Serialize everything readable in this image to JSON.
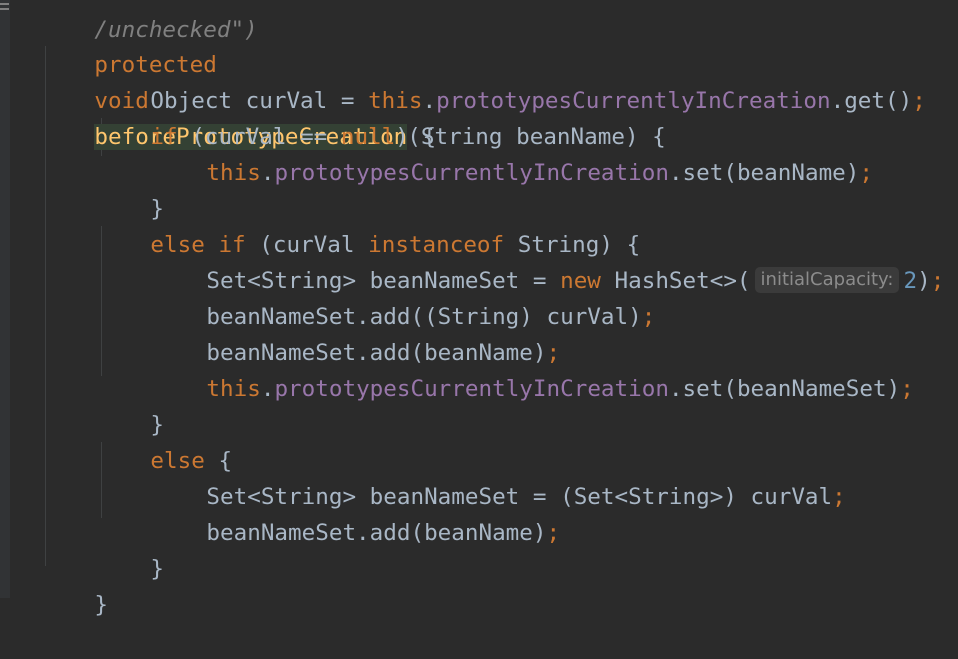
{
  "editor": {
    "annotation_partial": "/unchecked\")",
    "signature": {
      "kw_protected": "protected",
      "kw_void": "void",
      "method_name": "beforePrototypeCreation",
      "params": "(String beanName) {"
    },
    "lines": {
      "l2_type": "Object curVal = ",
      "l2_this": "this",
      "l2_dot": ".",
      "l2_field": "prototypesCurrentlyInCreation",
      "l2_rest": ".get()",
      "l2_semi": ";",
      "l3_kw": "if",
      "l3_mid": " (curVal == ",
      "l3_null": "null",
      "l3_rest": ") {",
      "l4_this": "this",
      "l4_dot": ".",
      "l4_field": "prototypesCurrentlyInCreation",
      "l4_rest": ".set(beanName)",
      "l4_semi": ";",
      "l5": "}",
      "l6_else": "else",
      "l6_if": "if",
      "l6_mid": " (curVal ",
      "l6_instanceof": "instanceof",
      "l6_rest": " String) {",
      "l7_a": "Set<String> beanNameSet = ",
      "l7_new": "new",
      "l7_b": " HashSet<>(",
      "l7_hint": "initialCapacity:",
      "l7_num": "2",
      "l7_c": ")",
      "l7_semi": ";",
      "l8": "beanNameSet.add((String) curVal)",
      "l8_semi": ";",
      "l9": "beanNameSet.add(beanName)",
      "l9_semi": ";",
      "l10_this": "this",
      "l10_dot": ".",
      "l10_field": "prototypesCurrentlyInCreation",
      "l10_rest": ".set(beanNameSet)",
      "l10_semi": ";",
      "l11": "}",
      "l12_else": "else",
      "l12_rest": " {",
      "l13": "Set<String> beanNameSet = (Set<String>) curVal",
      "l13_semi": ";",
      "l14": "beanNameSet.add(beanName)",
      "l14_semi": ";",
      "l15": "}",
      "l16": "}"
    }
  },
  "colors": {
    "background": "#2b2b2b",
    "keyword": "#cc7832",
    "method": "#ffc66d",
    "field": "#9876aa",
    "number": "#6897bb",
    "text": "#a9b7c6"
  }
}
